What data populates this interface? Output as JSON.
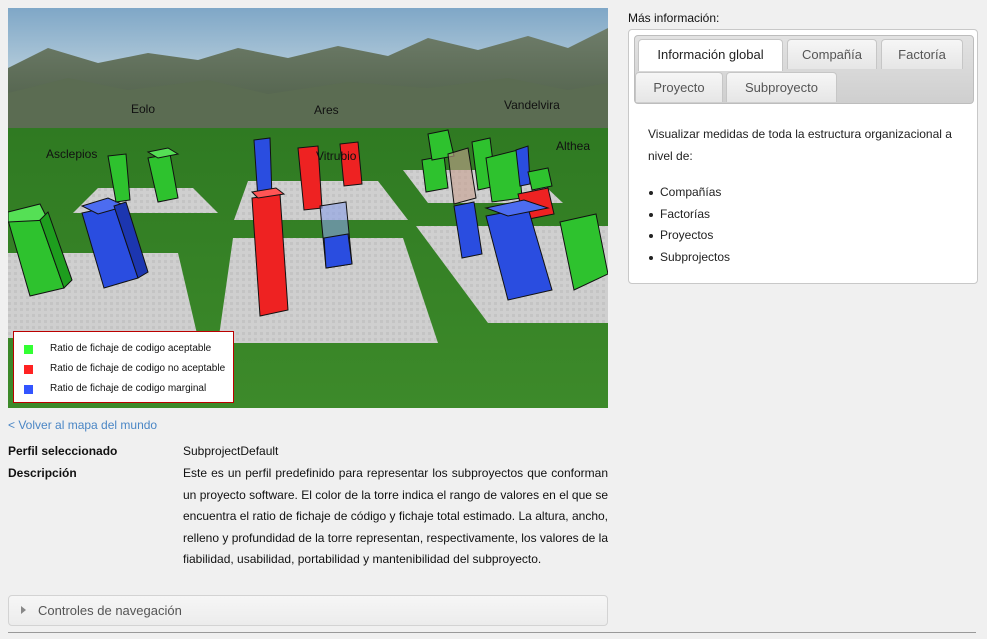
{
  "world": {
    "cities": [
      {
        "name": "Eolo"
      },
      {
        "name": "Ares"
      },
      {
        "name": "Vandelvira"
      },
      {
        "name": "Asclepios"
      },
      {
        "name": "Vitrubio"
      },
      {
        "name": "Althea"
      }
    ],
    "legend": [
      {
        "label": "Ratio de fichaje de codigo aceptable",
        "color": "#33ff33"
      },
      {
        "label": "Ratio de fichaje de codigo no aceptable",
        "color": "#ff2222"
      },
      {
        "label": "Ratio de fichaje de codigo marginal",
        "color": "#3355ff"
      }
    ]
  },
  "back_link": "< Volver al mapa del mundo",
  "profile": {
    "selected_label": "Perfil seleccionado",
    "selected_value": "SubprojectDefault",
    "description_label": "Descripción",
    "description_value": "Este es un perfil predefinido para representar los subproyectos que conforman un proyecto software. El color de la torre indica el rango de valores en el que se encuentra el ratio de fichaje de código y fichaje total estimado. La altura, ancho, relleno y profundidad de la torre representan, respectivamente, los valores de la fiabilidad, usabilidad, portabilidad y mantenibilidad del subproyecto."
  },
  "navigation_accordion": "Controles de navegación",
  "info": {
    "heading": "Más información:",
    "tabs": [
      {
        "label": "Información global",
        "active": true
      },
      {
        "label": "Compañía",
        "active": false
      },
      {
        "label": "Factoría",
        "active": false
      },
      {
        "label": "Proyecto",
        "active": false
      },
      {
        "label": "Subproyecto",
        "active": false
      }
    ],
    "text": "Visualizar medidas de toda la estructura organizacional a nivel de:",
    "items": [
      "Compañías",
      "Factorías",
      "Proyectos",
      "Subprojectos"
    ]
  },
  "colors": {
    "link": "#4a86c5",
    "grass": "#3a7a2a",
    "green_tower": "#33cc33",
    "red_tower": "#ee2222",
    "blue_tower": "#2a4de0"
  }
}
